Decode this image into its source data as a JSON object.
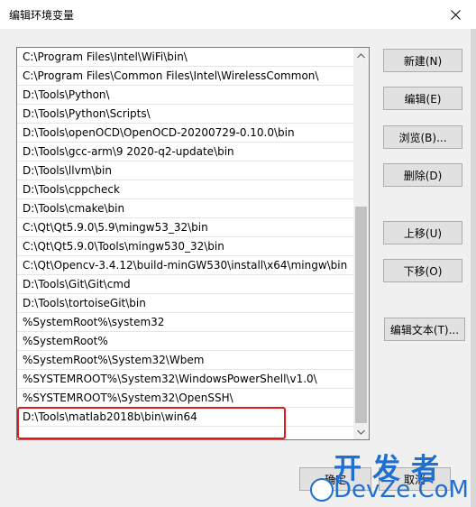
{
  "window": {
    "title": "编辑环境变量"
  },
  "paths": [
    "C:\\Program Files\\Intel\\WiFi\\bin\\",
    "C:\\Program Files\\Common Files\\Intel\\WirelessCommon\\",
    "D:\\Tools\\Python\\",
    "D:\\Tools\\Python\\Scripts\\",
    "D:\\Tools\\openOCD\\OpenOCD-20200729-0.10.0\\bin",
    "D:\\Tools\\gcc-arm\\9 2020-q2-update\\bin",
    "D:\\Tools\\llvm\\bin",
    "D:\\Tools\\cppcheck",
    "D:\\Tools\\cmake\\bin",
    "C:\\Qt\\Qt5.9.0\\5.9\\mingw53_32\\bin",
    "C:\\Qt\\Qt5.9.0\\Tools\\mingw530_32\\bin",
    "C:\\Qt\\Opencv-3.4.12\\build-minGW530\\install\\x64\\mingw\\bin",
    "D:\\Tools\\Git\\Git\\cmd",
    "D:\\Tools\\tortoiseGit\\bin",
    "%SystemRoot%\\system32",
    "%SystemRoot%",
    "%SystemRoot%\\System32\\Wbem",
    "%SYSTEMROOT%\\System32\\WindowsPowerShell\\v1.0\\",
    "%SYSTEMROOT%\\System32\\OpenSSH\\",
    "D:\\Tools\\matlab2018b\\bin\\win64"
  ],
  "buttons": {
    "new": "新建(N)",
    "edit": "编辑(E)",
    "browse": "浏览(B)...",
    "delete": "删除(D)",
    "move_up": "上移(U)",
    "move_down": "下移(O)",
    "edit_text": "编辑文本(T)...",
    "ok": "确定",
    "cancel": "取消"
  },
  "watermark": {
    "top": "开发者",
    "bottom": "DevZe.CoM"
  },
  "colors": {
    "highlight_border": "#e0191b",
    "watermark": "#1f6fd0"
  }
}
